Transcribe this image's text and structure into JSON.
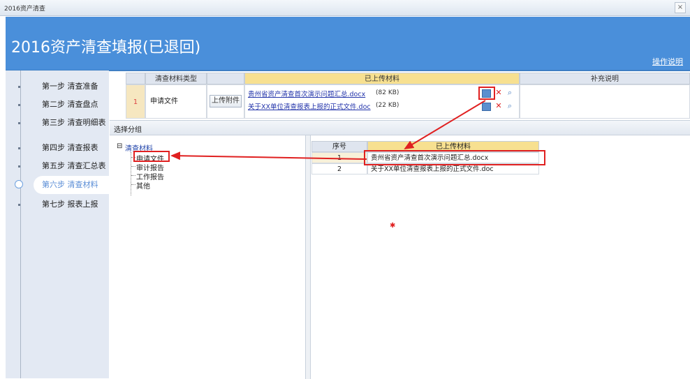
{
  "window": {
    "title": "2016资产清查",
    "close_glyph": "×"
  },
  "header": {
    "title": "2016资产清查填报(已退回)",
    "help_link": "操作说明"
  },
  "sidebar": {
    "steps": [
      {
        "label": "第一步 清查准备"
      },
      {
        "label": "第二步 清查盘点"
      },
      {
        "label": "第三步 清查明细表"
      },
      {
        "label": "第四步 清查报表"
      },
      {
        "label": "第五步 清查汇总表"
      },
      {
        "label": "第六步 清查材料",
        "active": true
      },
      {
        "label": "第七步 报表上报"
      }
    ]
  },
  "materials_table": {
    "headers": {
      "type": "清查材料类型",
      "uploaded": "已上传材料",
      "note": "补充说明"
    },
    "rows": [
      {
        "index": "1",
        "type": "申请文件",
        "upload_button": "上传附件",
        "files": [
          {
            "name": "贵州省资产清查首次演示问题汇总.docx",
            "size": "(82 KB)"
          },
          {
            "name": "关于XX单位清查报表上报的正式文件.doc",
            "size": "(22 KB)"
          }
        ]
      }
    ],
    "icons": [
      "edit-icon",
      "delete-icon",
      "preview-icon"
    ]
  },
  "dialog": {
    "title": "选择分组",
    "tree": {
      "root": "清查材料",
      "toggle": "⊟",
      "children": [
        "申请文件",
        "审计报告",
        "工作报告",
        "其他"
      ],
      "selected": "申请文件"
    },
    "grid": {
      "headers": {
        "index": "序号",
        "uploaded": "已上传材料"
      },
      "rows": [
        {
          "index": "1",
          "name": "贵州省资产清查首次演示问题汇总.docx"
        },
        {
          "index": "2",
          "name": "关于XX单位清查报表上报的正式文件.doc"
        }
      ]
    }
  },
  "colors": {
    "header_bg": "#4a8fda",
    "highlight_yellow": "#f7e090",
    "annotation_red": "#e02020",
    "active_step": "#5a8dd6"
  }
}
